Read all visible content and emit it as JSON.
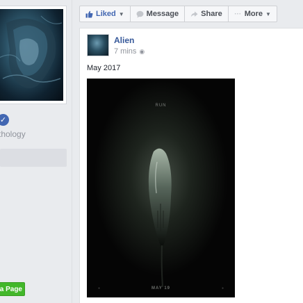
{
  "left": {
    "category": "thology",
    "create_page_label": "a Page"
  },
  "toolbar": {
    "liked_label": "Liked",
    "message_label": "Message",
    "share_label": "Share",
    "more_label": "More"
  },
  "post": {
    "author": "Alien",
    "timestamp": "7 mins",
    "text": "May 2017",
    "poster_tagline": "RUN",
    "poster_date": "MAY 19"
  },
  "colors": {
    "brand": "#4267b2",
    "link": "#365899",
    "green": "#42b72a",
    "background": "#e9ebee"
  },
  "icons": [
    "verified-badge-icon",
    "thumbs-up-icon",
    "message-icon",
    "share-arrow-icon",
    "more-dots-icon",
    "globe-icon"
  ]
}
